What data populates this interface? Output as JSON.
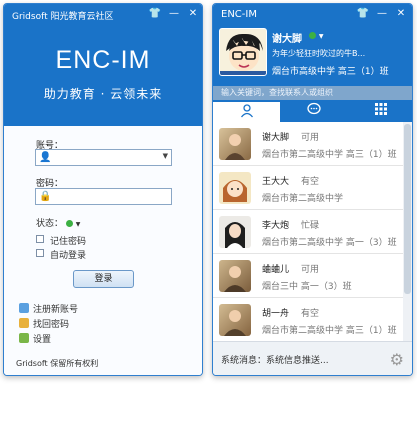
{
  "login": {
    "title": "Gridsoft 阳光教育云社区",
    "brand": "ENC-IM",
    "slogan": "助力教育 · 云领未来",
    "account_label": "账号：",
    "account_value": "",
    "password_label": "密码：",
    "status_label": "状态：",
    "remember_label": "记住密码",
    "autologin_label": "自动登录",
    "login_button": "登录",
    "register_link": "注册新账号",
    "recover_link": "找回密码",
    "settings_link": "设置",
    "copyright": "Gridsoft 保留所有权利"
  },
  "main": {
    "title": "ENC-IM",
    "user_name": "谢大脚",
    "signature": "为年少轻狂时吹过的牛B...",
    "school": "烟台市高级中学   高三（1）班",
    "search_placeholder": "输入关键词，查找联系人或组织",
    "tabs": [
      {
        "name": "contacts",
        "icon": "person-icon"
      },
      {
        "name": "chats",
        "icon": "chat-bubble-icon"
      },
      {
        "name": "apps",
        "icon": "grid-icon"
      }
    ],
    "contacts": [
      {
        "name": "谢大脚",
        "status": "可用",
        "school": "烟台市第二高级中学   高三（1）班"
      },
      {
        "name": "王大大",
        "status": "有空",
        "school": "烟台市第二高级中学"
      },
      {
        "name": "李大炮",
        "status": "忙碌",
        "school": "烟台市第二高级中学   高一（3）班"
      },
      {
        "name": "蛐蛐儿",
        "status": "可用",
        "school": "烟台三中   高一（3）班"
      },
      {
        "name": "胡一舟",
        "status": "有空",
        "school": "烟台市第二高级中学   高三（1）班"
      }
    ],
    "system_message": "系统消息：系统信息推送..."
  },
  "colors": {
    "accent": "#1a73c8",
    "online": "#3cb043"
  }
}
